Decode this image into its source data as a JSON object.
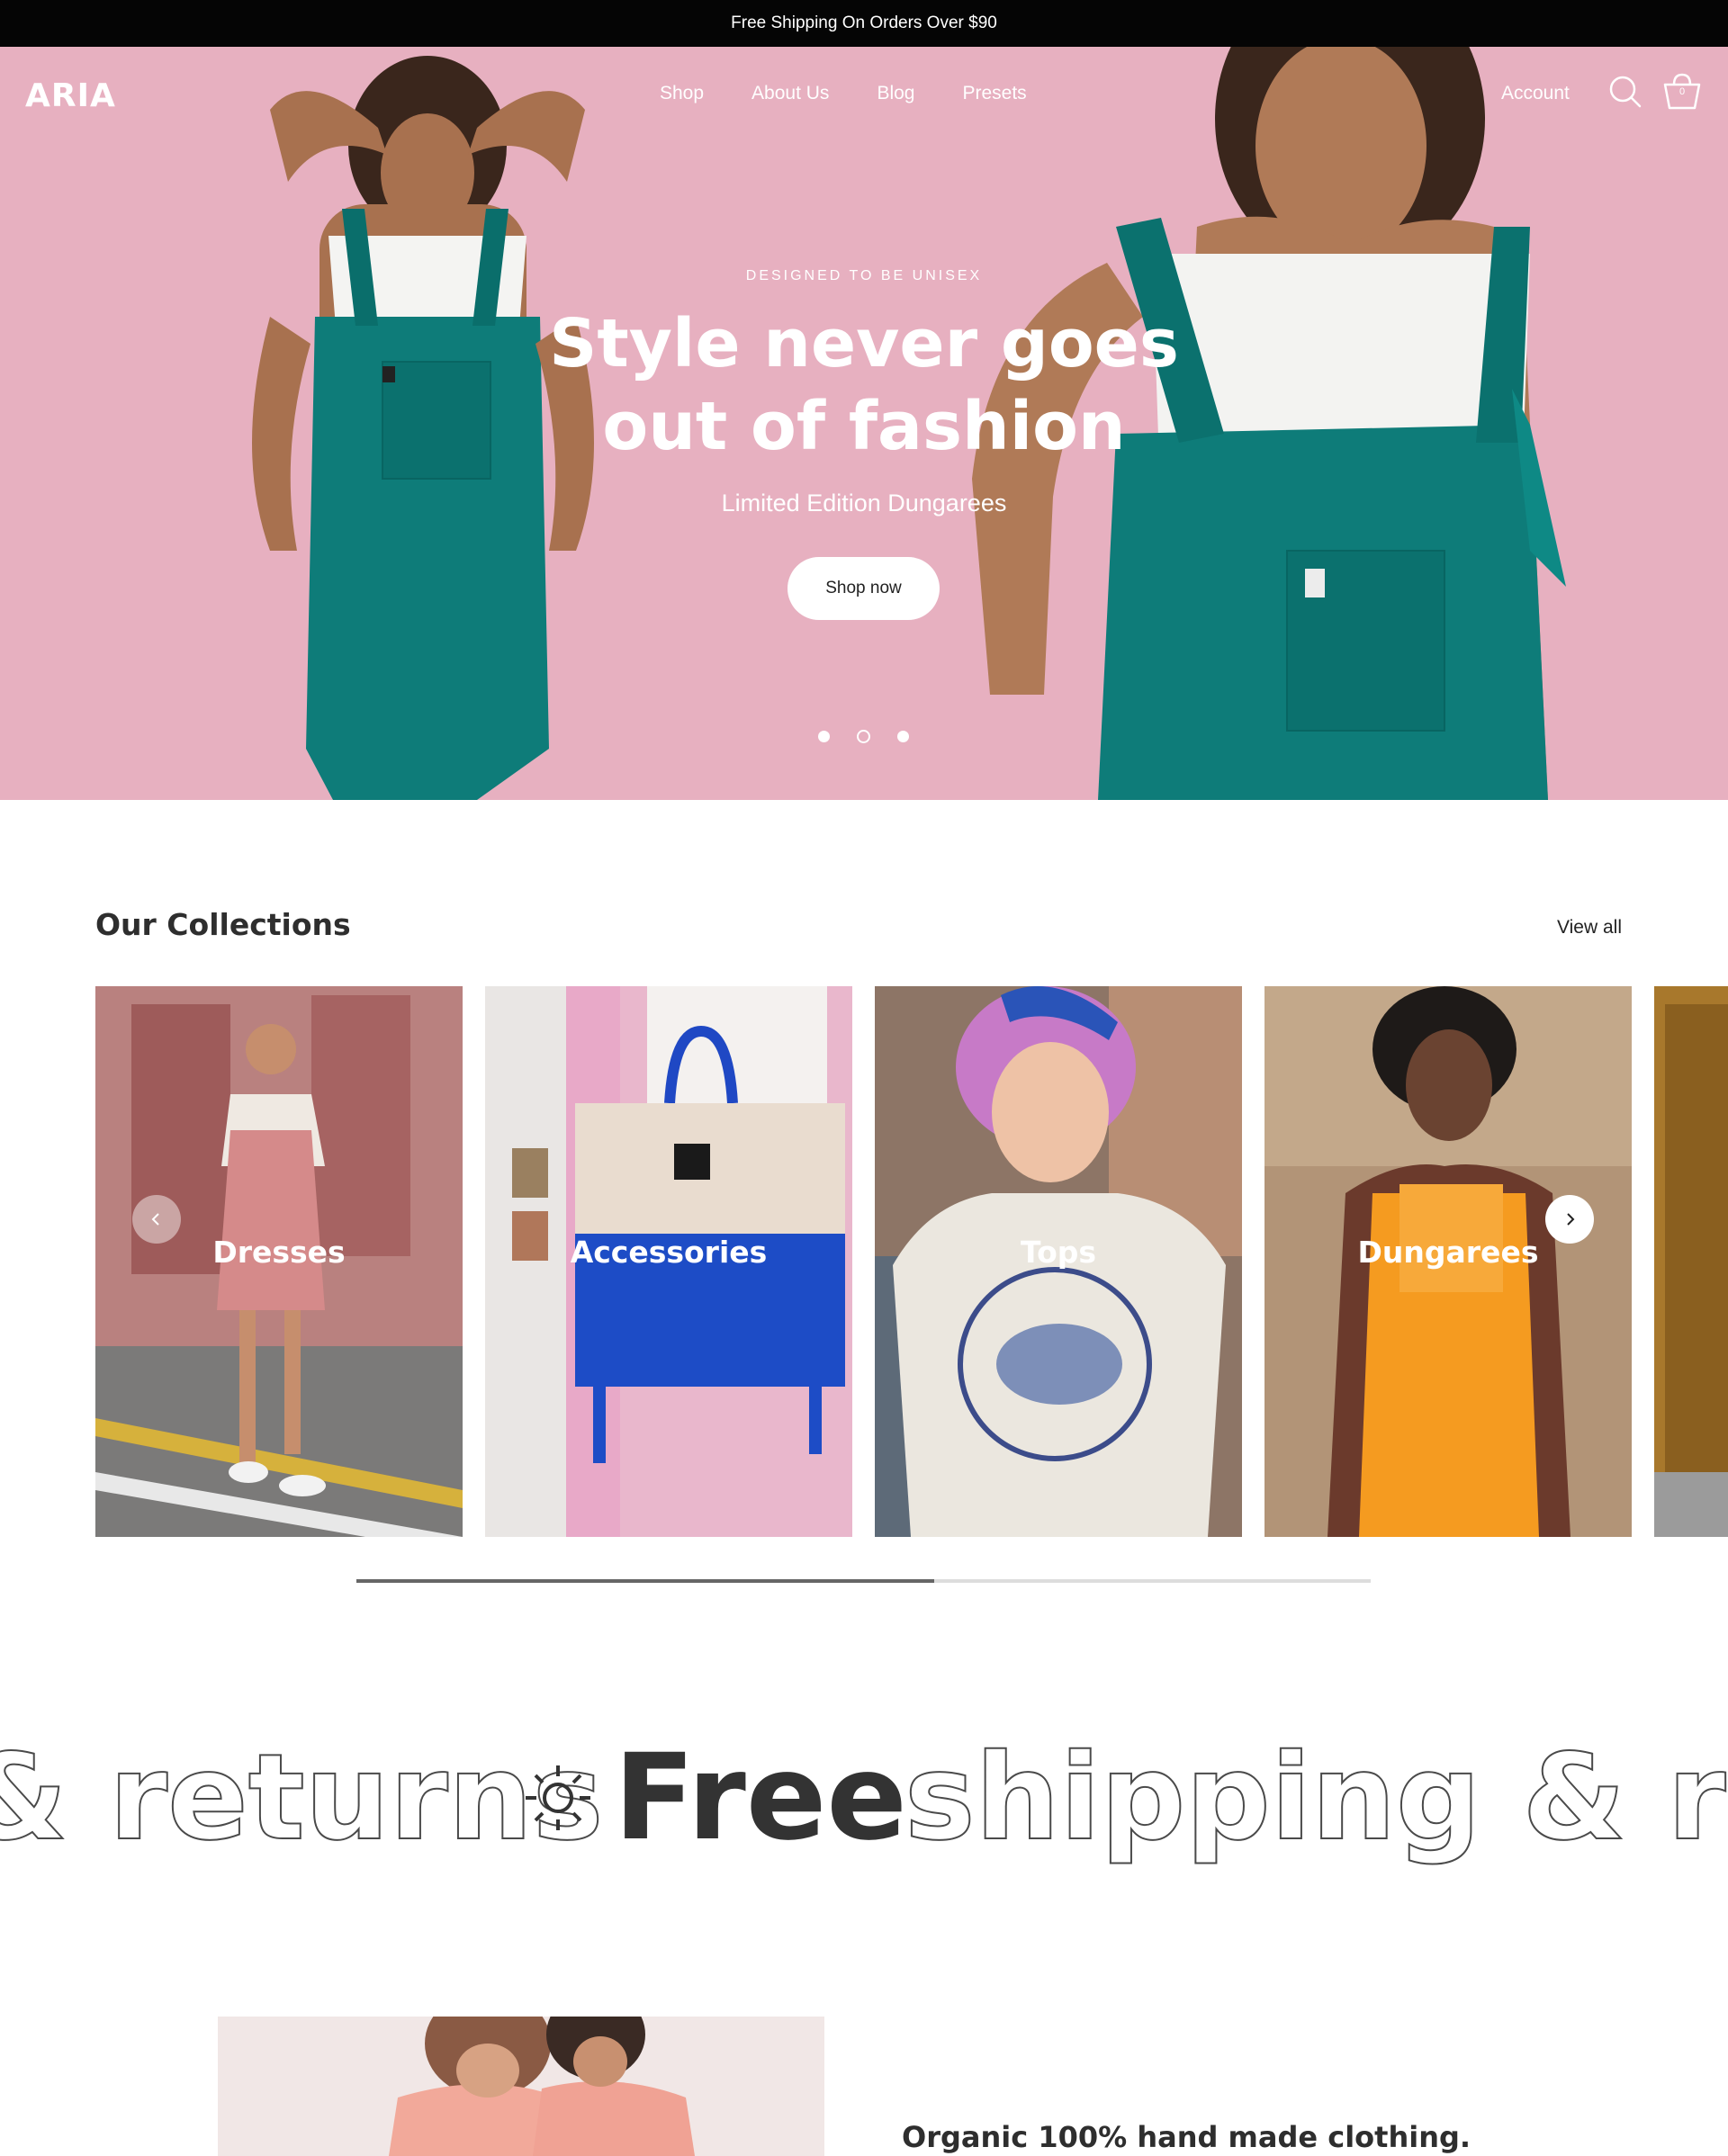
{
  "announcement": {
    "text": "Free Shipping On Orders Over $90"
  },
  "header": {
    "logo": "ARIA",
    "nav": [
      {
        "label": "Shop"
      },
      {
        "label": "About Us"
      },
      {
        "label": "Blog"
      },
      {
        "label": "Presets"
      }
    ],
    "account_label": "Account",
    "cart_count": "0",
    "icons": [
      "search-icon",
      "cart-icon"
    ]
  },
  "hero": {
    "eyebrow": "DESIGNED TO BE UNISEX",
    "headline": "Style never goes out of fashion",
    "subheadline": "Limited Edition Dungarees",
    "cta_label": "Shop now",
    "slide_count": 3,
    "active_slide": 2,
    "background_color": "#e6afbf",
    "accent_color": "#0e7c79"
  },
  "collections": {
    "title": "Our Collections",
    "view_all_label": "View all",
    "items": [
      {
        "label": "Dresses"
      },
      {
        "label": "Accessories"
      },
      {
        "label": "Tops"
      },
      {
        "label": "Dungarees"
      }
    ],
    "scroll_progress": 0.57
  },
  "marquee": {
    "words": [
      "& returns",
      "Free",
      "shipping & ret"
    ],
    "icon": "sun-icon"
  },
  "about": {
    "heading": "Organic 100% hand made clothing."
  }
}
